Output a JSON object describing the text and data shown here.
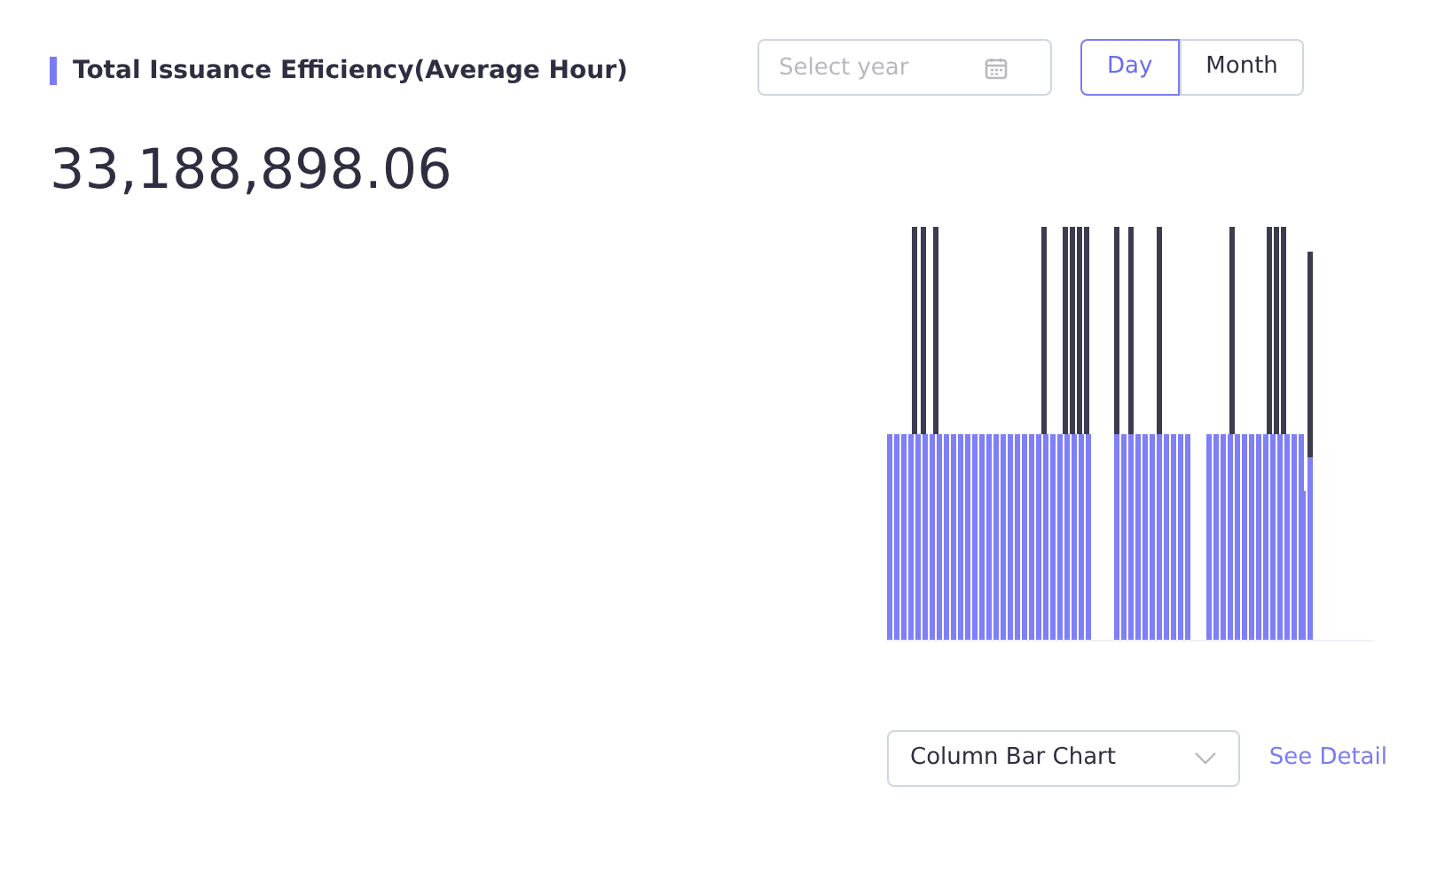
{
  "title": "Total Issuance Efficiency(Average Hour)",
  "year_field": {
    "placeholder": "Select year"
  },
  "period_toggle": [
    {
      "label": "Day",
      "selected": true
    },
    {
      "label": "Month",
      "selected": false
    }
  ],
  "total_value": "33,188,898.06",
  "chart_type_select": {
    "value": "Column Bar Chart"
  },
  "see_detail_link": "See Detail"
}
